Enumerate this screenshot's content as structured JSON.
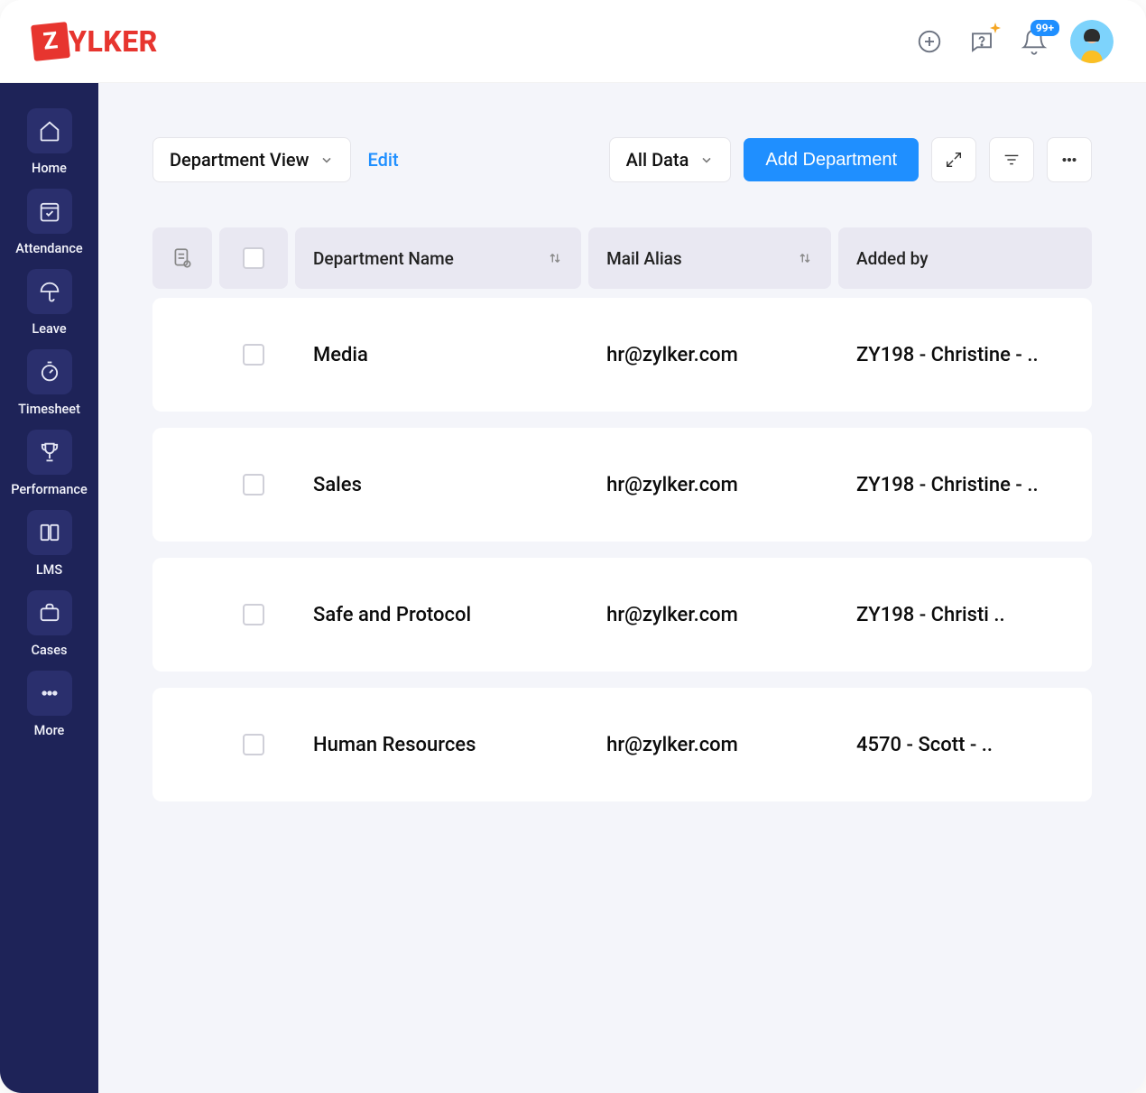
{
  "header": {
    "logo_badge": "Z",
    "logo_text": "YLKER",
    "notification_badge": "99+"
  },
  "sidebar": {
    "items": [
      {
        "label": "Home"
      },
      {
        "label": "Attendance"
      },
      {
        "label": "Leave"
      },
      {
        "label": "Timesheet"
      },
      {
        "label": "Performance"
      },
      {
        "label": "LMS"
      },
      {
        "label": "Cases"
      },
      {
        "label": "More"
      }
    ]
  },
  "toolbar": {
    "view_dropdown": "Department View",
    "edit_link": "Edit",
    "data_dropdown": "All Data",
    "add_button": "Add Department"
  },
  "table": {
    "headers": {
      "department": "Department Name",
      "mail": "Mail Alias",
      "added": "Added by"
    },
    "rows": [
      {
        "department": "Media",
        "mail": "hr@zylker.com",
        "added": "ZY198 - Christine - .."
      },
      {
        "department": "Sales",
        "mail": "hr@zylker.com",
        "added": "ZY198 - Christine - .."
      },
      {
        "department": "Safe and Protocol",
        "mail": "hr@zylker.com",
        "added": "ZY198 - Christi .."
      },
      {
        "department": "Human Resources",
        "mail": "hr@zylker.com",
        "added": "4570 - Scott - .."
      }
    ]
  }
}
